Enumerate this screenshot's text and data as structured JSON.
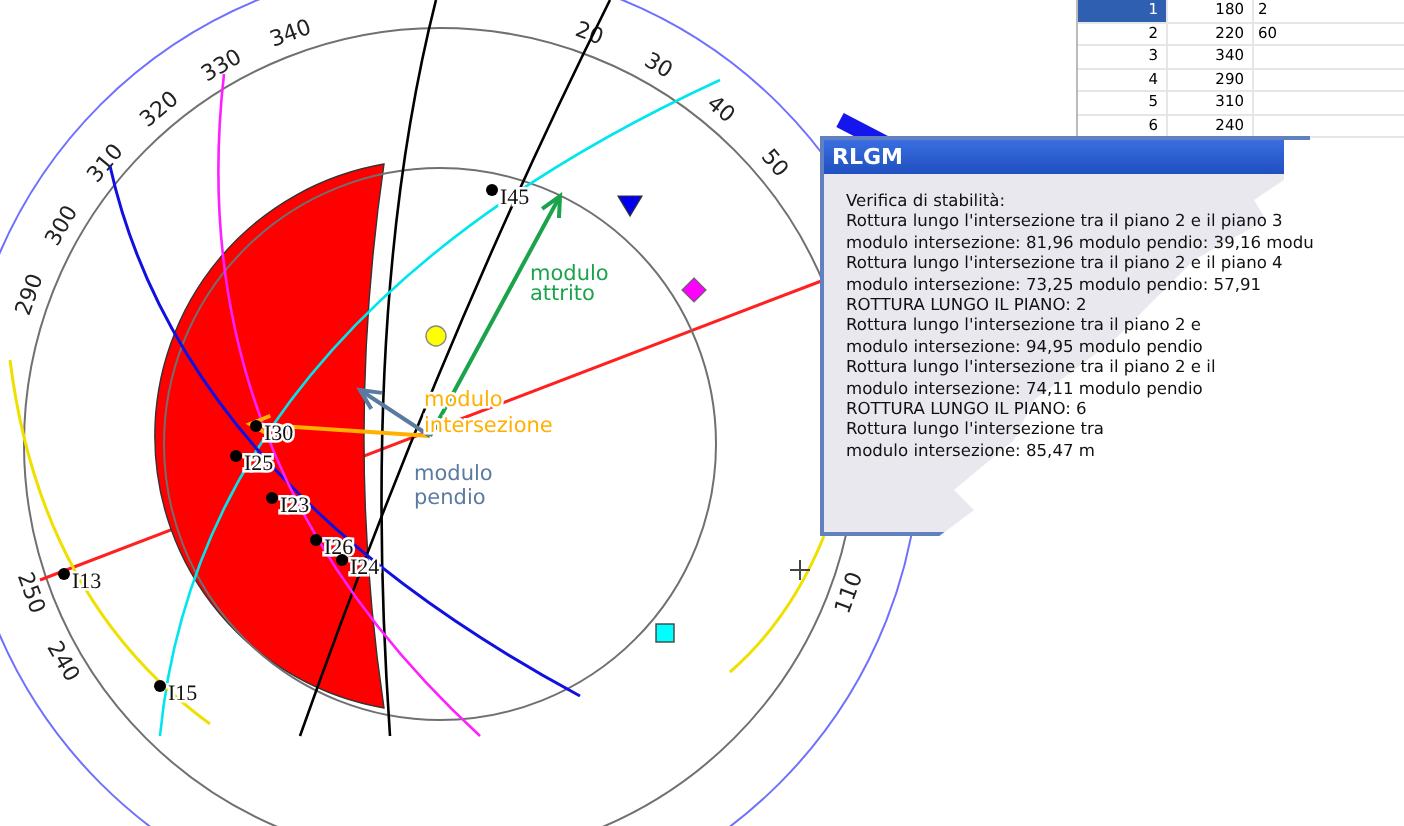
{
  "stereonet": {
    "degree_labels": [
      "20",
      "30",
      "40",
      "50",
      "110",
      "240",
      "250",
      "290",
      "300",
      "310",
      "320",
      "330",
      "340"
    ],
    "points": [
      "I45",
      "I30",
      "I25",
      "I23",
      "I26",
      "I24",
      "I13",
      "I15"
    ],
    "vectors": [
      {
        "label": "modulo attrito",
        "color": "#1aa34a"
      },
      {
        "label": "modulo intersezione",
        "color": "#ffb000"
      },
      {
        "label": "modulo pendio",
        "color": "#5b7aa0"
      }
    ]
  },
  "table": {
    "rows": [
      {
        "cells": [
          "1",
          "180",
          "2"
        ],
        "selected": true
      },
      {
        "cells": [
          "2",
          "220",
          "60"
        ],
        "selected": false
      },
      {
        "cells": [
          "3",
          "340",
          ""
        ],
        "selected": false
      },
      {
        "cells": [
          "4",
          "290",
          ""
        ],
        "selected": false
      },
      {
        "cells": [
          "5",
          "310",
          ""
        ],
        "selected": false
      },
      {
        "cells": [
          "6",
          "240",
          ""
        ],
        "selected": false
      }
    ]
  },
  "dialog": {
    "title": "RLGM",
    "lines": [
      "Verifica di stabilità:",
      "Rottura lungo l'intersezione tra il piano 2 e il piano 3",
      "modulo intersezione: 81,96  modulo pendio: 39,16  modu",
      "Rottura lungo l'intersezione tra il piano 2 e il piano 4",
      "modulo intersezione: 73,25  modulo pendio: 57,91",
      "ROTTURA LUNGO IL PIANO: 2",
      "Rottura lungo l'intersezione tra il piano 2 e",
      "modulo intersezione: 94,95  modulo pendio",
      "Rottura lungo l'intersezione tra il piano 2 e il",
      "modulo intersezione: 74,11  modulo pendio",
      "ROTTURA LUNGO IL PIANO: 6",
      "Rottura lungo l'intersezione tra",
      "modulo intersezione: 85,47  m"
    ]
  }
}
